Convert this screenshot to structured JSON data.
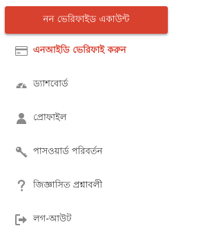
{
  "header": {
    "title": "নন ভেরিফাইড একাউন্ট"
  },
  "menu": {
    "items": [
      {
        "label": "এনআইডি ভেরিফাই করুন",
        "icon": "id-card-icon"
      },
      {
        "label": "ড্যাশবোর্ড",
        "icon": "dashboard-gauge-icon"
      },
      {
        "label": "প্রোফাইল",
        "icon": "user-icon"
      },
      {
        "label": "পাসওয়ার্ড পরিবর্তন",
        "icon": "key-icon"
      },
      {
        "label": "জিজ্ঞাসিত প্রশ্নাবলী",
        "icon": "question-icon"
      },
      {
        "label": "লগ-আউট",
        "icon": "logout-icon"
      }
    ]
  },
  "colors": {
    "banner": "#d9412f",
    "highlight_text": "#d63a2a",
    "icon": "#8a8a8a",
    "text": "#333333"
  }
}
